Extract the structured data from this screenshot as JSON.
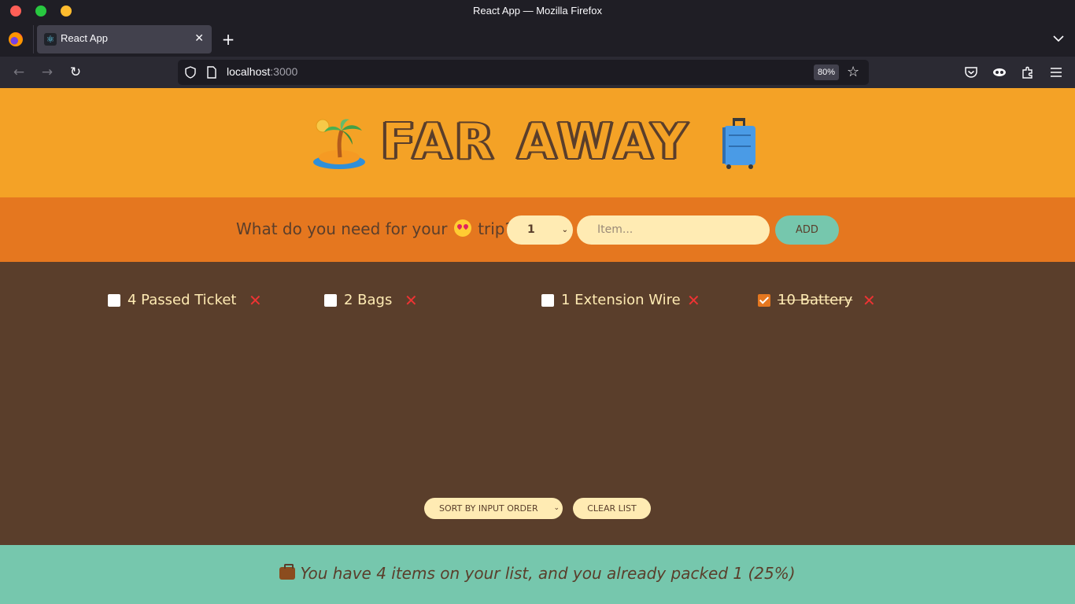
{
  "browser": {
    "window_title": "React App — Mozilla Firefox",
    "tab_title": "React App",
    "url_host": "localhost",
    "url_port": ":3000",
    "zoom": "80%"
  },
  "app": {
    "title": "FAR AWAY",
    "form": {
      "question_start": "What do you need for your",
      "question_end": "trip?",
      "quantity": "1",
      "item_placeholder": "Item...",
      "add_label": "ADD"
    },
    "items": [
      {
        "quantity": 4,
        "description": "Passed Ticket",
        "packed": false,
        "label": "4 Passed Ticket"
      },
      {
        "quantity": 2,
        "description": "Bags",
        "packed": false,
        "label": "2 Bags"
      },
      {
        "quantity": 1,
        "description": "Extension Wire",
        "packed": false,
        "label": "1 Extension Wire"
      },
      {
        "quantity": 10,
        "description": "Battery",
        "packed": true,
        "label": "10 Battery"
      }
    ],
    "delete_glyph": "✕",
    "sort_label": "SORT BY INPUT ORDER",
    "clear_label": "CLEAR LIST",
    "stats_text": "You have 4 items on your list, and you already packed 1 (25%)"
  },
  "colors": {
    "header": "#f4a226",
    "form": "#e5771f",
    "list": "#5a3e2b",
    "stats": "#76c7ad",
    "cream": "#ffebb3"
  }
}
